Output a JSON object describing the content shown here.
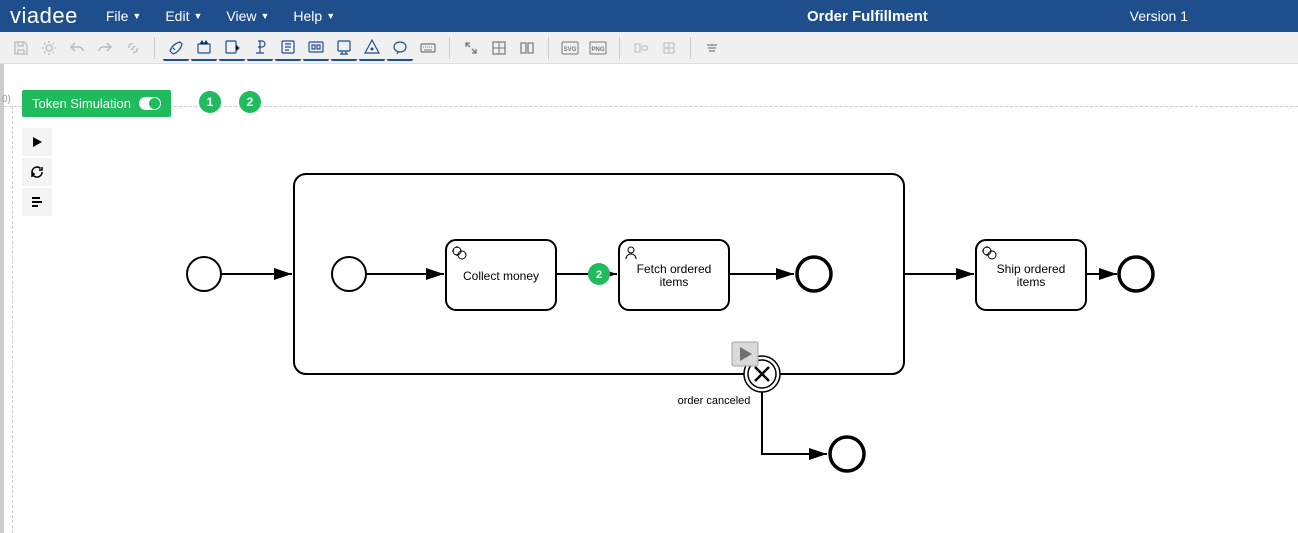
{
  "app": {
    "logo": "viadee",
    "title": "Order Fulfillment",
    "version": "Version 1"
  },
  "menus": {
    "file": "File",
    "edit": "Edit",
    "view": "View",
    "help": "Help"
  },
  "sim": {
    "label": "Token Simulation",
    "badges": [
      "1",
      "2"
    ],
    "token_count": "2"
  },
  "diagram": {
    "tasks": {
      "collect": "Collect money",
      "fetch": "Fetch ordered items",
      "ship": "Ship ordered items"
    },
    "event_label": "order canceled"
  },
  "origin_marker": "0)"
}
